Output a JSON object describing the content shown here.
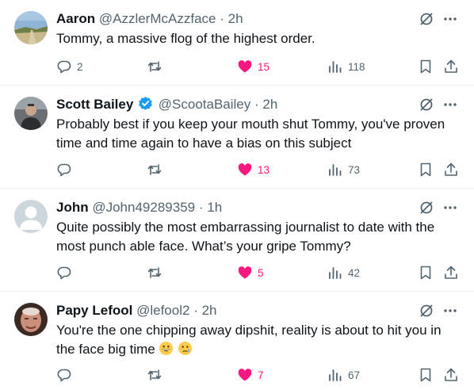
{
  "tweets": [
    {
      "name": "Aaron",
      "handle": "@AzzlerMcAzzface",
      "separator": "·",
      "time": "2h",
      "verified": false,
      "text": "Tommy, a massive flog of the highest order.",
      "replies": "2",
      "reposts": "",
      "likes": "15",
      "views": "118",
      "liked": true
    },
    {
      "name": "Scott Bailey",
      "handle": "@ScootaBailey",
      "separator": "·",
      "time": "2h",
      "verified": true,
      "text": "Probably best if you keep your mouth shut Tommy, you've proven time and time again to have a bias on this subject",
      "replies": "",
      "reposts": "",
      "likes": "13",
      "views": "73",
      "liked": true
    },
    {
      "name": "John",
      "handle": "@John49289359",
      "separator": "·",
      "time": "1h",
      "verified": false,
      "text": "Quite possibly the most embarrassing journalist to date with the most punch able face. What’s your gripe Tommy?",
      "replies": "",
      "reposts": "",
      "likes": "5",
      "views": "42",
      "liked": true
    },
    {
      "name": "Papy Lefool",
      "handle": "@lefool2",
      "separator": "·",
      "time": "2h",
      "verified": false,
      "text": "You're the one chipping away dipshit, reality is about to hit you in the face big time",
      "emojis": [
        "grinning-face-emoji",
        "crying-face-emoji"
      ],
      "replies": "",
      "reposts": "",
      "likes": "7",
      "views": "67",
      "liked": true
    }
  ],
  "icons": [
    "grok-icon",
    "more-icon",
    "reply-icon",
    "repost-icon",
    "like-icon",
    "views-icon",
    "bookmark-icon",
    "share-icon",
    "verified-badge-icon"
  ],
  "colors": {
    "like": "#f91880",
    "verified": "#1d9bf0",
    "secondary_text": "#536471",
    "divider": "#eff3f4"
  }
}
